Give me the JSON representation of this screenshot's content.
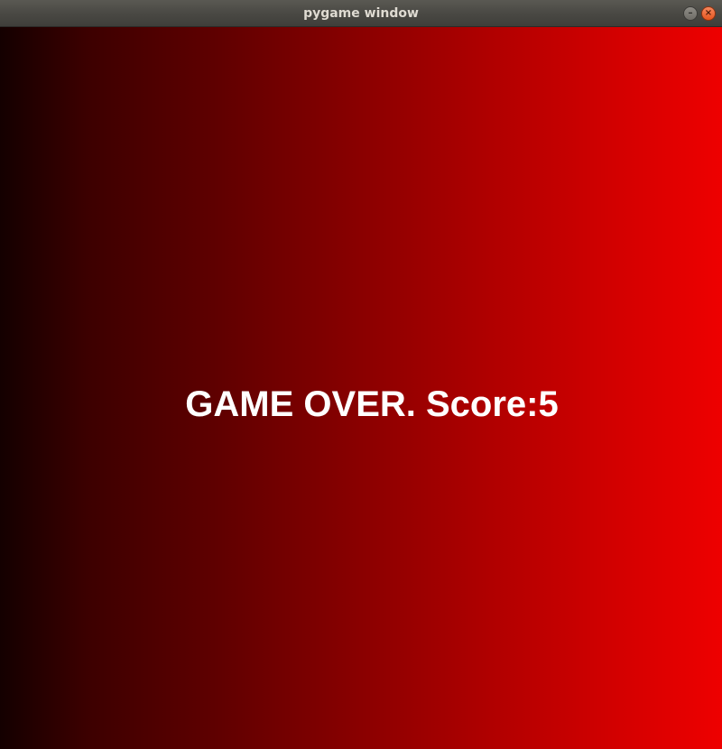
{
  "window": {
    "title": "pygame window",
    "minimize_icon": "minimize-icon",
    "close_icon": "close-icon"
  },
  "game": {
    "message": "GAME OVER. Score:5",
    "score": 5,
    "background_gradient": [
      "#140000",
      "#ee0000"
    ],
    "text_color": "#ffffff"
  }
}
